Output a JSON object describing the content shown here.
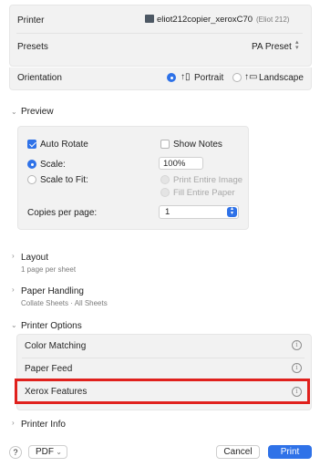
{
  "printer": {
    "label": "Printer",
    "name": "eliot212copier_xeroxC70",
    "alias": "(Eliot 212)"
  },
  "presets": {
    "label": "Presets",
    "value": "PA Preset"
  },
  "orientation": {
    "label": "Orientation",
    "portrait": "Portrait",
    "landscape": "Landscape"
  },
  "preview": {
    "title": "Preview",
    "auto_rotate": "Auto Rotate",
    "show_notes": "Show Notes",
    "scale_label": "Scale:",
    "scale_value": "100%",
    "scale_to_fit": "Scale to Fit:",
    "print_entire_image": "Print Entire Image",
    "fill_entire_paper": "Fill Entire Paper",
    "copies_label": "Copies per page:",
    "copies_value": "1"
  },
  "layout": {
    "title": "Layout",
    "subtitle": "1 page per sheet"
  },
  "paper_handling": {
    "title": "Paper Handling",
    "subtitle": "Collate Sheets · All Sheets"
  },
  "printer_options": {
    "title": "Printer Options",
    "items": [
      "Color Matching",
      "Paper Feed",
      "Xerox Features"
    ]
  },
  "printer_info": {
    "title": "Printer Info"
  },
  "footer": {
    "help": "?",
    "pdf": "PDF",
    "cancel": "Cancel",
    "print": "Print"
  },
  "colors": {
    "accent": "#2f72e8",
    "highlight": "#e0211d"
  }
}
